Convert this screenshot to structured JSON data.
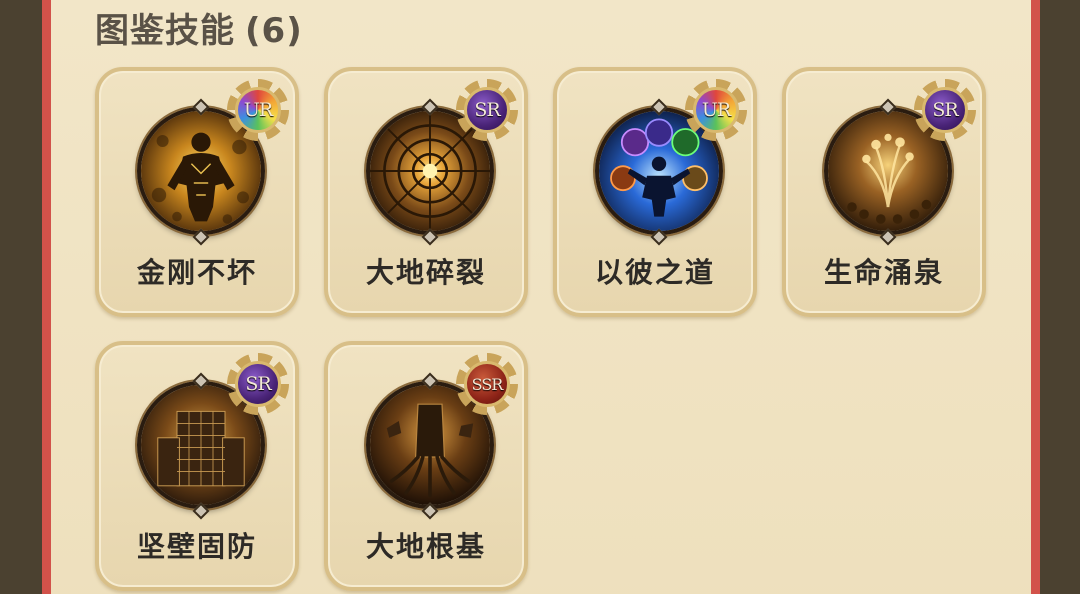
{
  "section": {
    "title": "图鉴技能",
    "count": "(6)"
  },
  "skills": [
    {
      "name": "金刚不坏",
      "rarity": "UR",
      "icon": "golden-warrior-icon"
    },
    {
      "name": "大地碎裂",
      "rarity": "SR",
      "icon": "earth-shatter-icon"
    },
    {
      "name": "以彼之道",
      "rarity": "UR",
      "icon": "mirror-elements-icon"
    },
    {
      "name": "生命涌泉",
      "rarity": "SR",
      "icon": "life-spring-icon"
    },
    {
      "name": "坚壁固防",
      "rarity": "SR",
      "icon": "stone-wall-icon"
    },
    {
      "name": "大地根基",
      "rarity": "SSR",
      "icon": "earth-root-icon"
    }
  ],
  "colors": {
    "panel_bg": "#f1e5c6",
    "frame_red": "#d2524a",
    "side_bg": "#4b4130",
    "card_border": "#d8bf88"
  }
}
